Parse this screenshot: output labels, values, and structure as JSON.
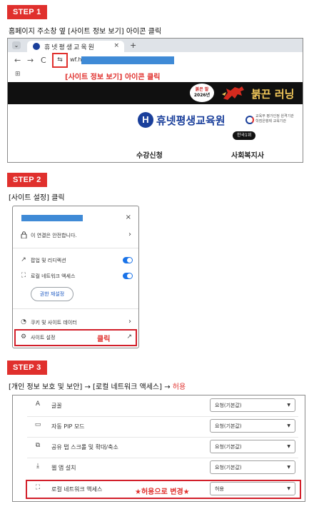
{
  "step1": {
    "badge": "STEP 1",
    "caption": "홈페이지 주소창 옆 [사이트 정보 보기] 아이콘 클릭",
    "browser": {
      "tab_dropdown": "⌄",
      "tab_title": "휴넷평생교육원",
      "tab_close": "×",
      "new_tab": "+",
      "back": "←",
      "forward": "→",
      "reload": "C",
      "site_info_icon": "⇆",
      "url_prefix": "wf.h",
      "apps_icon": "⊞",
      "annotation": "[사이트 정보 보기] 아이콘 클릭"
    },
    "banner": {
      "badge_line1": "붉은 말",
      "badge_line2": "2026년",
      "headline": "붉끈 러닝"
    },
    "site": {
      "logo_mark": "H",
      "logo_text": "휴넷평생교육원",
      "cert_line1": "교육부 평가인정 원격기관",
      "cert_line2": "학점은행제 교육기관",
      "rank_badge": "한국1위",
      "menu": [
        "수강신청",
        "사회복지사"
      ]
    }
  },
  "step2": {
    "badge": "STEP 2",
    "caption": "[사이트 설정] 클릭",
    "popup": {
      "close": "×",
      "connection": "이 연결은 안전합니다.",
      "popups_redirects": "팝업 및 리디렉션",
      "local_network": "로컬 네트워크 액세스",
      "reset_permissions": "권한 재설정",
      "cookies": "쿠키 및 사이트 데이터",
      "site_settings": "사이트 설정",
      "click_label": "클릭"
    }
  },
  "step3": {
    "badge": "STEP 3",
    "caption_prefix": "[개인 정보 보호 및 보안] → [로컬 네트워크 액세스] → ",
    "caption_accent": "허용",
    "rows": [
      {
        "icon": "A",
        "label": "글꼴",
        "value": "요청(기본값)"
      },
      {
        "icon": "▭",
        "label": "자동 PIP 모드",
        "value": "요청(기본값)"
      },
      {
        "icon": "⧉",
        "label": "공유 탭 스크롤 및 확대/축소",
        "value": "요청(기본값)"
      },
      {
        "icon": "⤓",
        "label": "웹 앱 설치",
        "value": "요청(기본값)"
      },
      {
        "icon": "⛶",
        "label": "로컬 네트워크 액세스",
        "value": "허용"
      }
    ],
    "change_label": "★허용으로 변경★"
  },
  "colors": {
    "accent_red": "#e0302d",
    "brand_blue": "#1a3f9b",
    "toggle_blue": "#1a73e8"
  }
}
